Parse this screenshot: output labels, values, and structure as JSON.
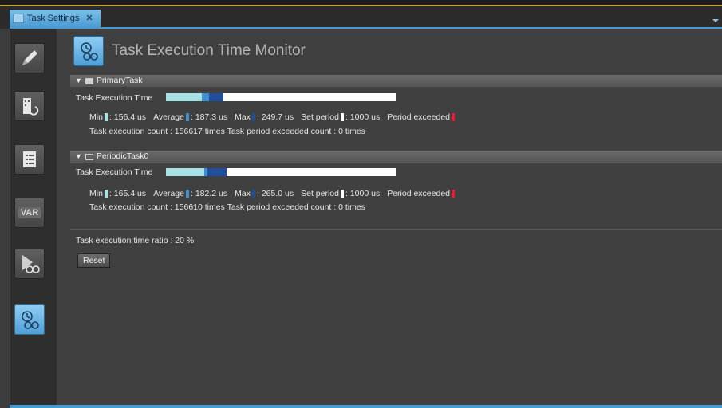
{
  "tab": {
    "label": "Task Settings",
    "close": "✕"
  },
  "page": {
    "title": "Task Execution Time Monitor"
  },
  "colors": {
    "min": "#a6e1e6",
    "average": "#3f8fd0",
    "max": "#1f4e9c",
    "set_period": "#ffffff",
    "period_exceeded": "#e0203a"
  },
  "tasks": [
    {
      "name": "PrimaryTask",
      "exec_label": "Task Execution Time",
      "min_label": "Min",
      "min_value": "156.4 us",
      "avg_label": "Average",
      "avg_value": "187.3 us",
      "max_label": "Max",
      "max_value": "249.7 us",
      "set_label": "Set period",
      "set_value": "1000 us",
      "exceeded_label": "Period exceeded",
      "counts_text": "Task execution count : 156617 times    Task period exceeded count : 0 times",
      "bar": {
        "min": 156.4,
        "average": 187.3,
        "max": 249.7,
        "set_period": 1000
      }
    },
    {
      "name": "PeriodicTask0",
      "exec_label": "Task Execution Time",
      "min_label": "Min",
      "min_value": "165.4 us",
      "avg_label": "Average",
      "avg_value": "182.2 us",
      "max_label": "Max",
      "max_value": "265.0 us",
      "set_label": "Set period",
      "set_value": "1000 us",
      "exceeded_label": "Period exceeded",
      "counts_text": "Task execution count : 156610 times    Task period exceeded count : 0 times",
      "bar": {
        "min": 165.4,
        "average": 182.2,
        "max": 265.0,
        "set_period": 1000
      }
    }
  ],
  "ratio_text": "Task execution time ratio : 20 %",
  "reset_label": "Reset",
  "sidebar": [
    {
      "icon": "pencil-icon"
    },
    {
      "icon": "building-icon"
    },
    {
      "icon": "list-icon"
    },
    {
      "icon": "var-icon",
      "label": "VAR"
    },
    {
      "icon": "execution-watch-icon"
    },
    {
      "icon": "task-monitor-icon"
    }
  ]
}
